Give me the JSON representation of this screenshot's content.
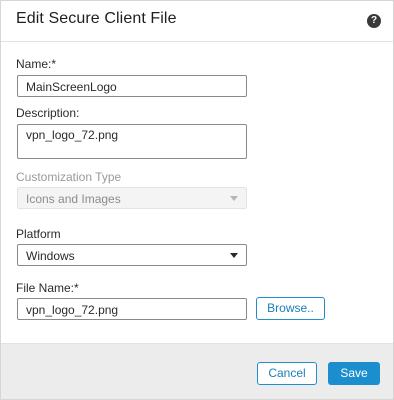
{
  "dialog": {
    "title": "Edit Secure Client File",
    "help_icon": "help-icon",
    "help_glyph": "?"
  },
  "form": {
    "name_label": "Name:*",
    "name_value": "MainScreenLogo",
    "description_label": "Description:",
    "description_value": "vpn_logo_72.png",
    "customization_label": "Customization Type",
    "customization_value": "Icons and Images",
    "platform_label": "Platform",
    "platform_value": "Windows",
    "filename_label": "File Name:*",
    "filename_value": "vpn_logo_72.png",
    "browse_label": "Browse.."
  },
  "footer": {
    "cancel_label": "Cancel",
    "save_label": "Save"
  },
  "colors": {
    "accent": "#1b8fcd",
    "footer_bg": "#ececec"
  }
}
